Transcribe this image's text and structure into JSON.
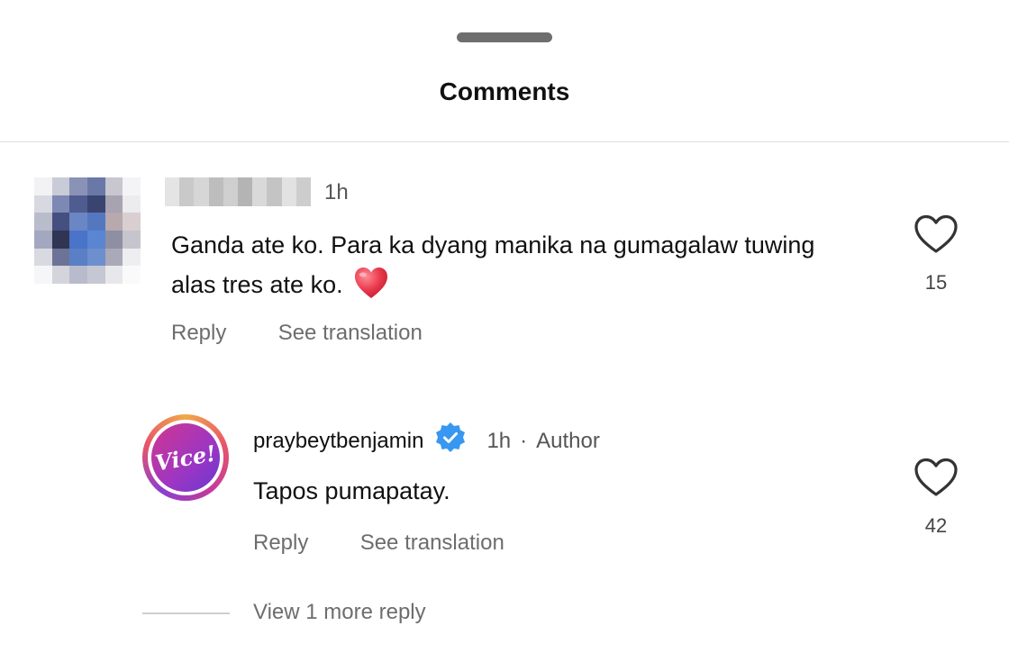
{
  "sheet": {
    "title": "Comments"
  },
  "comments": [
    {
      "username": "",
      "time": "1h",
      "text": "Ganda ate ko. Para ka dyang manika na gumagalaw tuwing alas tres ate ko.",
      "emoji": "heart-emoji",
      "likes": "15",
      "reply_label": "Reply",
      "translate_label": "See translation"
    }
  ],
  "reply": {
    "avatar_text": "Vice!",
    "username": "praybeytbenjamin",
    "verified": true,
    "time": "1h",
    "separator": "·",
    "badge": "Author",
    "text": "Tapos pumapatay.",
    "likes": "42",
    "reply_label": "Reply",
    "translate_label": "See translation"
  },
  "thread": {
    "view_more_label": "View 1 more reply"
  },
  "colors": {
    "verified": "#3897f0",
    "secondary_text": "#6d6d6d",
    "avatar_gradient_start": "#d2368f",
    "avatar_gradient_end": "#6a38d0"
  }
}
